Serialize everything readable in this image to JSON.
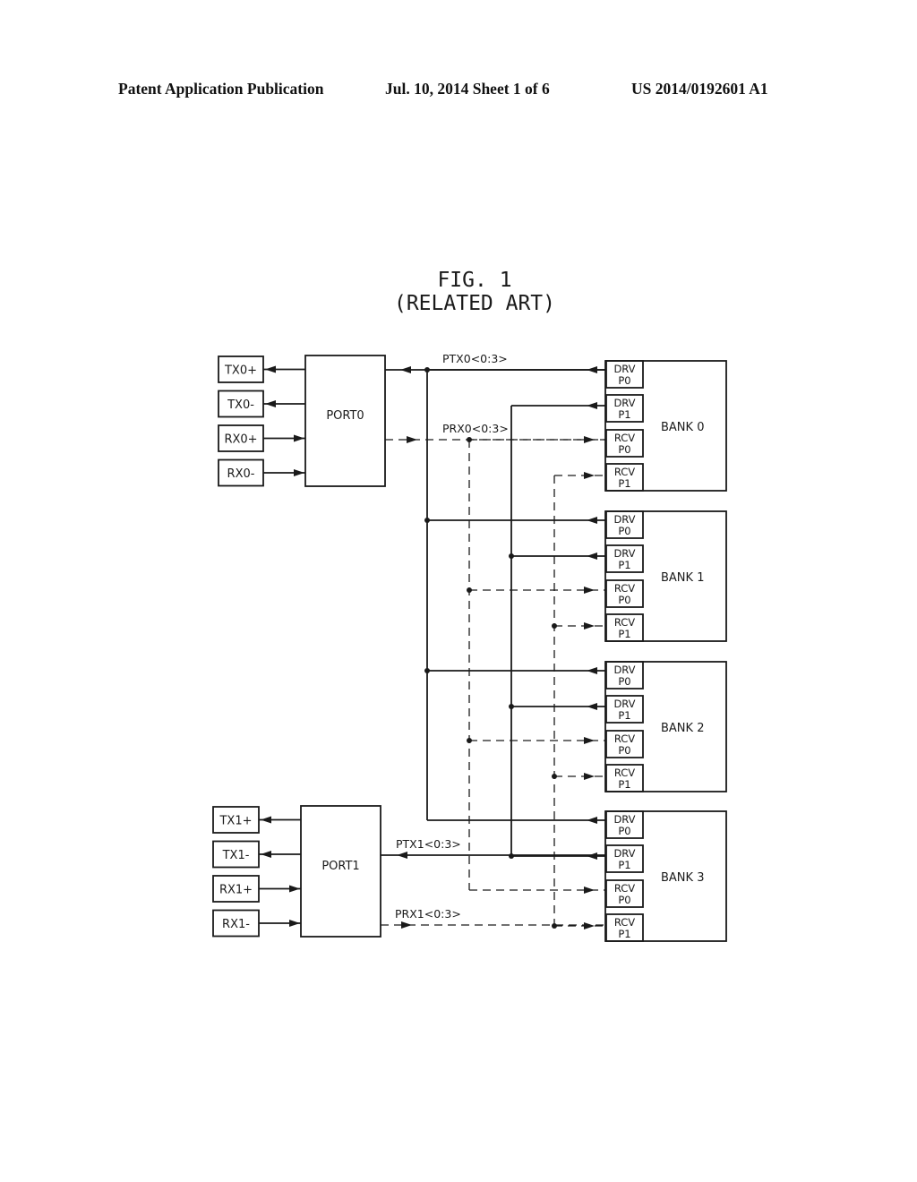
{
  "header": {
    "left": "Patent Application Publication",
    "center": "Jul. 10, 2014   Sheet 1 of 6",
    "right": "US 2014/0192601 A1"
  },
  "figure": {
    "title": "FIG. 1",
    "subtitle": "(RELATED ART)"
  },
  "ports": [
    {
      "name": "PORT0",
      "pins": [
        "TX0+",
        "TX0-",
        "RX0+",
        "RX0-"
      ],
      "tx_bus": "PTX0<0:3>",
      "rx_bus": "PRX0<0:3>"
    },
    {
      "name": "PORT1",
      "pins": [
        "TX1+",
        "TX1-",
        "RX1+",
        "RX1-"
      ],
      "tx_bus": "PTX1<0:3>",
      "rx_bus": "PRX1<0:3>"
    }
  ],
  "banks": [
    {
      "name": "BANK 0",
      "units": [
        [
          "DRV",
          "P0"
        ],
        [
          "DRV",
          "P1"
        ],
        [
          "RCV",
          "P0"
        ],
        [
          "RCV",
          "P1"
        ]
      ]
    },
    {
      "name": "BANK 1",
      "units": [
        [
          "DRV",
          "P0"
        ],
        [
          "DRV",
          "P1"
        ],
        [
          "RCV",
          "P0"
        ],
        [
          "RCV",
          "P1"
        ]
      ]
    },
    {
      "name": "BANK 2",
      "units": [
        [
          "DRV",
          "P0"
        ],
        [
          "DRV",
          "P1"
        ],
        [
          "RCV",
          "P0"
        ],
        [
          "RCV",
          "P1"
        ]
      ]
    },
    {
      "name": "BANK 3",
      "units": [
        [
          "DRV",
          "P0"
        ],
        [
          "DRV",
          "P1"
        ],
        [
          "RCV",
          "P0"
        ],
        [
          "RCV",
          "P1"
        ]
      ]
    }
  ],
  "colors": {
    "ink": "#1a1a1a",
    "background": "#ffffff"
  }
}
